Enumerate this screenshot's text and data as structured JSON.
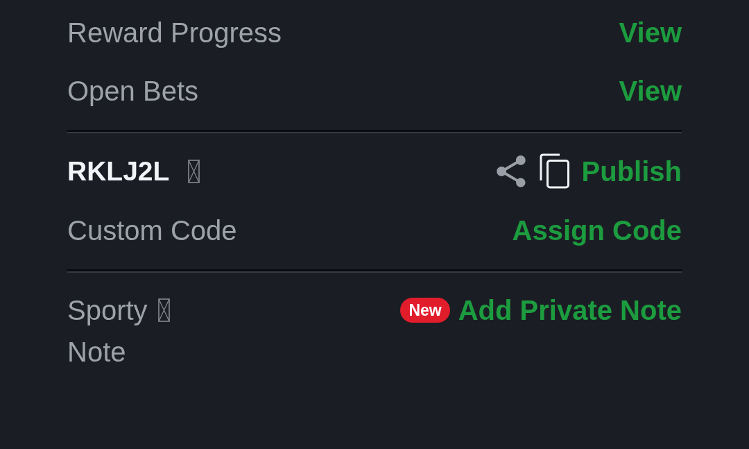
{
  "sections": [
    {
      "rows": [
        {
          "kind": "link",
          "label": "Reward Progress",
          "action": "View"
        },
        {
          "kind": "link",
          "label": "Open Bets",
          "action": "View"
        }
      ]
    },
    {
      "rows": [
        {
          "kind": "code",
          "code": "RKLJ2L",
          "unknown_glyph": true,
          "action": "Publish"
        },
        {
          "kind": "link",
          "label": "Custom Code",
          "action": "Assign Code"
        }
      ]
    },
    {
      "rows": [
        {
          "kind": "note",
          "label_lines": [
            "Sporty",
            "Note"
          ],
          "unknown_glyph": true,
          "badge": "New",
          "action": "Add Private Note"
        }
      ]
    }
  ]
}
